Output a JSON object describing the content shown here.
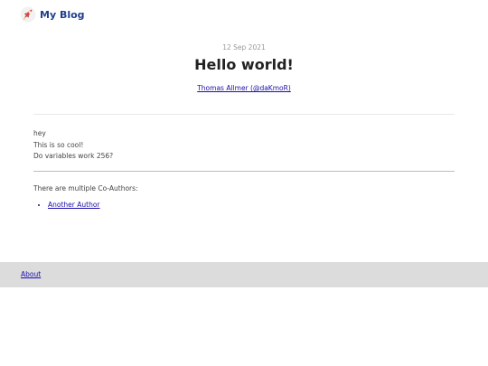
{
  "header": {
    "logo_icon": "rocket-icon",
    "brand_label": "My Blog"
  },
  "post": {
    "date": "12 Sep 2021",
    "title": "Hello world!",
    "author_link": "Thomas Allmer (@daKmoR)",
    "content_lines": [
      "hey",
      "This is so cool!",
      "Do variables work 256?"
    ],
    "coauthors_label": "There are multiple Co-Authors:",
    "coauthors": [
      "Another Author"
    ]
  },
  "footer": {
    "about_label": "About"
  },
  "colors": {
    "brand": "#1f3f8c",
    "link": "#1a0dab",
    "footer_bg": "#dcdcdc",
    "rocket_body": "#d9453a"
  }
}
